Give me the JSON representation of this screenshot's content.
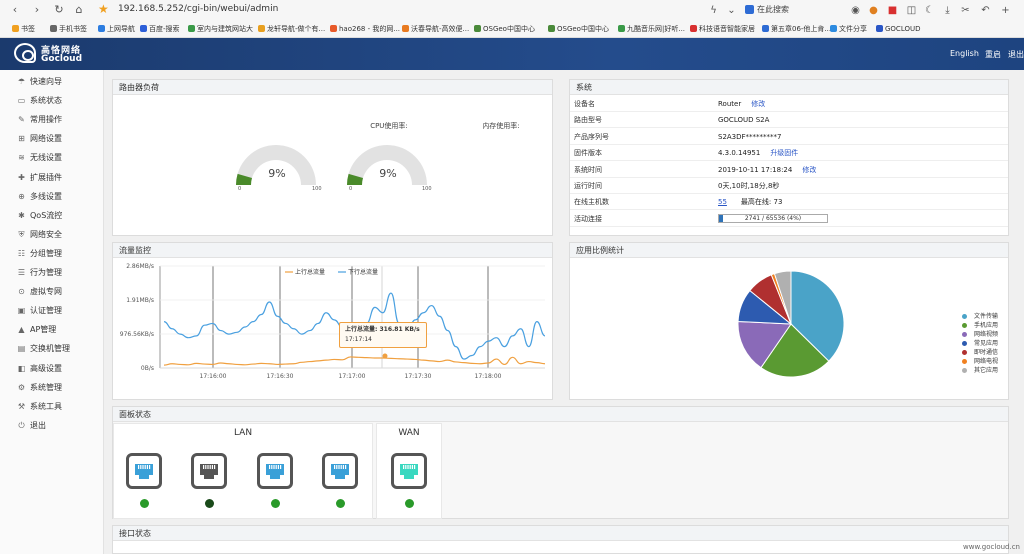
{
  "browser": {
    "url": "192.168.5.252/cgi-bin/webui/admin",
    "search_placeholder": "在此搜索",
    "bookmarks": [
      {
        "label": "书签",
        "color": "#f0a020"
      },
      {
        "label": "手机书签",
        "color": "#666666"
      },
      {
        "label": "上网导航",
        "color": "#2d7de0"
      },
      {
        "label": "百度-搜索",
        "color": "#2d5fd8"
      },
      {
        "label": "室内与建筑网站大",
        "color": "#3a9a48"
      },
      {
        "label": "龙轩导航-做个有...",
        "color": "#e8a020"
      },
      {
        "label": "hao268 - 我的网...",
        "color": "#e85a2a"
      },
      {
        "label": "沃春导航-高效便...",
        "color": "#e87a20"
      },
      {
        "label": "OSGeo中国中心",
        "color": "#4a8a3a"
      },
      {
        "label": "OSGeo中国中心",
        "color": "#4a8a3a"
      },
      {
        "label": "九酷音乐网|好听...",
        "color": "#3a9a48"
      },
      {
        "label": "科技语音智能家居",
        "color": "#d83030"
      },
      {
        "label": "第五章06-他上肯...",
        "color": "#2d6bd4"
      },
      {
        "label": "文件分享",
        "color": "#2d8be0"
      },
      {
        "label": "GOCLOUD",
        "color": "#2a56c6"
      }
    ]
  },
  "header": {
    "logo_cn": "高恪网络",
    "logo_en": "Gocloud",
    "links": [
      "English",
      "重启",
      "退出"
    ]
  },
  "sidebar": {
    "items": [
      {
        "label": "快速向导",
        "icon": "umbrella-icon"
      },
      {
        "label": "系统状态",
        "icon": "monitor-icon"
      },
      {
        "label": "常用操作",
        "icon": "wrench-icon"
      },
      {
        "label": "网络设置",
        "icon": "network-icon"
      },
      {
        "label": "无线设置",
        "icon": "wifi-icon"
      },
      {
        "label": "扩展插件",
        "icon": "puzzle-icon"
      },
      {
        "label": "多线设置",
        "icon": "multiline-icon"
      },
      {
        "label": "QoS流控",
        "icon": "qos-icon"
      },
      {
        "label": "网络安全",
        "icon": "shield-icon"
      },
      {
        "label": "分组管理",
        "icon": "group-icon"
      },
      {
        "label": "行为管理",
        "icon": "behavior-icon"
      },
      {
        "label": "虚拟专网",
        "icon": "vpn-icon"
      },
      {
        "label": "认证管理",
        "icon": "auth-icon"
      },
      {
        "label": "AP管理",
        "icon": "ap-icon"
      },
      {
        "label": "交换机管理",
        "icon": "switch-icon"
      },
      {
        "label": "高级设置",
        "icon": "advanced-icon"
      },
      {
        "label": "系统管理",
        "icon": "gear-icon"
      },
      {
        "label": "系统工具",
        "icon": "tools-icon"
      },
      {
        "label": "退出",
        "icon": "power-icon"
      }
    ]
  },
  "load_panel": {
    "title": "路由器负荷",
    "cpu": {
      "label": "CPU使用率:",
      "value": 9,
      "value_text": "9%",
      "min": "0",
      "max": "100"
    },
    "mem": {
      "label": "内存使用率:",
      "value": 9,
      "value_text": "9%",
      "min": "0",
      "max": "100"
    }
  },
  "system_panel": {
    "title": "系统",
    "rows": [
      {
        "key": "设备名",
        "value": "Router",
        "link": "修改"
      },
      {
        "key": "路由型号",
        "value": "GOCLOUD S2A",
        "link": ""
      },
      {
        "key": "产品序列号",
        "value": "S2A3DF*********7",
        "link": ""
      },
      {
        "key": "固件版本",
        "value": "4.3.0.14951",
        "link": "升级固件"
      },
      {
        "key": "系统时间",
        "value": "2019-10-11 17:18:24",
        "link": "修改"
      },
      {
        "key": "运行时间",
        "value": "0天,10时,18分,8秒",
        "link": ""
      },
      {
        "key": "在线主机数",
        "value": "55",
        "extra": "最高在线:  73",
        "link": ""
      },
      {
        "key": "活动连接",
        "value": "2741 / 65536 (4%)",
        "fraction": 0.04,
        "link": ""
      }
    ]
  },
  "traffic_panel": {
    "title": "流量监控",
    "tooltip_line1": "上行总流量: 316.81 KB/s",
    "tooltip_line2": "17:17:14"
  },
  "chart_data": {
    "type": "line",
    "legend": [
      "上行总流量",
      "下行总流量"
    ],
    "y_ticks": [
      "2.86MB/s",
      "1.91MB/s",
      "976.56KB/s",
      "0B/s"
    ],
    "x_ticks": [
      "17:16:00",
      "17:16:30",
      "17:17:00",
      "17:17:30",
      "17:18:00"
    ],
    "series": [
      {
        "name": "上行总流量",
        "color": "#f0a040",
        "values": [
          0.08,
          0.12,
          0.1,
          0.09,
          0.13,
          0.11,
          0.1,
          0.14,
          0.12,
          0.1,
          0.09,
          0.11,
          0.13,
          0.12,
          0.1,
          0.11,
          0.12,
          0.16,
          0.18,
          0.2,
          0.22,
          0.24,
          0.23,
          0.31,
          0.3,
          0.29,
          0.28,
          0.28,
          0.27,
          0.26,
          0.25,
          0.24,
          0.22,
          0.2,
          0.18,
          0.22,
          0.17,
          0.15,
          0.13,
          0.12,
          0.14,
          0.25,
          0.1,
          0.3,
          0.12,
          0.18,
          0.15,
          0.12
        ]
      },
      {
        "name": "下行总流量",
        "color": "#4aa0e0",
        "values": [
          1.3,
          1.1,
          0.95,
          0.85,
          0.9,
          1.2,
          1.25,
          1.05,
          0.95,
          1.0,
          1.15,
          1.3,
          1.5,
          1.85,
          1.45,
          1.25,
          1.1,
          0.95,
          1.05,
          1.25,
          1.55,
          1.35,
          1.15,
          1.0,
          0.95,
          1.25,
          1.7,
          1.55,
          2.1,
          1.25,
          1.05,
          1.35,
          1.55,
          1.75,
          1.45,
          1.05,
          0.6,
          0.25,
          0.35,
          0.6,
          0.75,
          0.85,
          0.6,
          0.9,
          1.1,
          0.6,
          1.3,
          0.9
        ]
      }
    ],
    "ylim": [
      0,
      2.86
    ]
  },
  "app_stats_panel": {
    "title": "应用比例统计",
    "pie": [
      {
        "name": "文件传输",
        "value": 37,
        "color": "#4aa3c8"
      },
      {
        "name": "手机应用",
        "value": 22,
        "color": "#5a9a32"
      },
      {
        "name": "网络视频",
        "value": 16,
        "color": "#8a6ab8"
      },
      {
        "name": "常见应用",
        "value": 10,
        "color": "#2d5bb0"
      },
      {
        "name": "即时通信",
        "value": 8,
        "color": "#b03030"
      },
      {
        "name": "网络电视",
        "value": 1,
        "color": "#f08020"
      },
      {
        "name": "其它应用",
        "value": 5,
        "color": "#b0b0b0"
      }
    ]
  },
  "panel_state": {
    "title": "面板状态",
    "lan_label": "LAN",
    "wan_label": "WAN",
    "lan_ports": [
      {
        "color": "#3aa0d8",
        "led": "#2a9a2a"
      },
      {
        "color": "#555555",
        "led": "#1a4a1a"
      },
      {
        "color": "#3aa0d8",
        "led": "#2a9a2a"
      },
      {
        "color": "#3aa0d8",
        "led": "#2a9a2a"
      }
    ],
    "wan_ports": [
      {
        "color": "#3ad8c0",
        "led": "#2a9a2a"
      }
    ]
  },
  "iface_panel": {
    "title": "接口状态"
  },
  "watermark": "www.gocloud.cn"
}
